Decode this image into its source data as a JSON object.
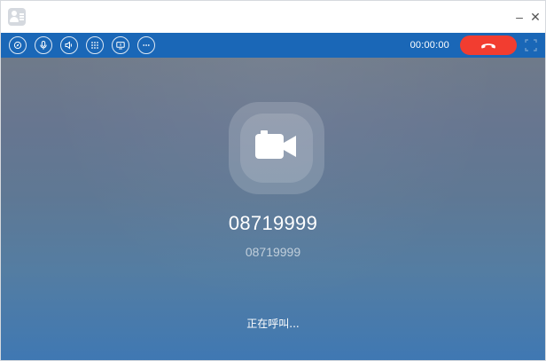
{
  "window": {
    "minimize_glyph": "–",
    "close_glyph": "✕"
  },
  "toolbar": {
    "icons": [
      "compass-icon",
      "microphone-icon",
      "speaker-icon",
      "dialpad-icon",
      "screen-share-icon",
      "more-icon"
    ],
    "timer": "00:00:00",
    "hangup_icon": "phone-hangup-icon",
    "fullscreen_icon": "fullscreen-icon",
    "accent_color": "#1a67b7",
    "hangup_color": "#f23d30"
  },
  "call": {
    "avatar_icon": "video-camera-icon",
    "number": "08719999",
    "subnumber": "08719999",
    "status": "正在呼叫..."
  }
}
